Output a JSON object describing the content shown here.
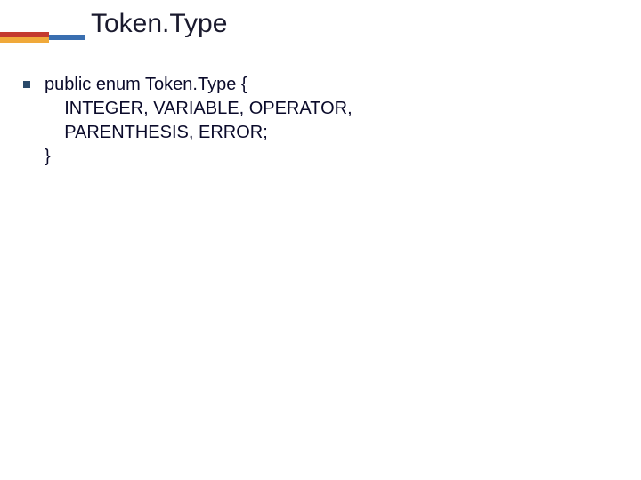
{
  "slide": {
    "title": "Token.Type",
    "code": {
      "line1": "public enum Token.Type {",
      "line2": "    INTEGER, VARIABLE, OPERATOR,",
      "line3": "    PARENTHESIS, ERROR;",
      "line4": "}"
    }
  }
}
